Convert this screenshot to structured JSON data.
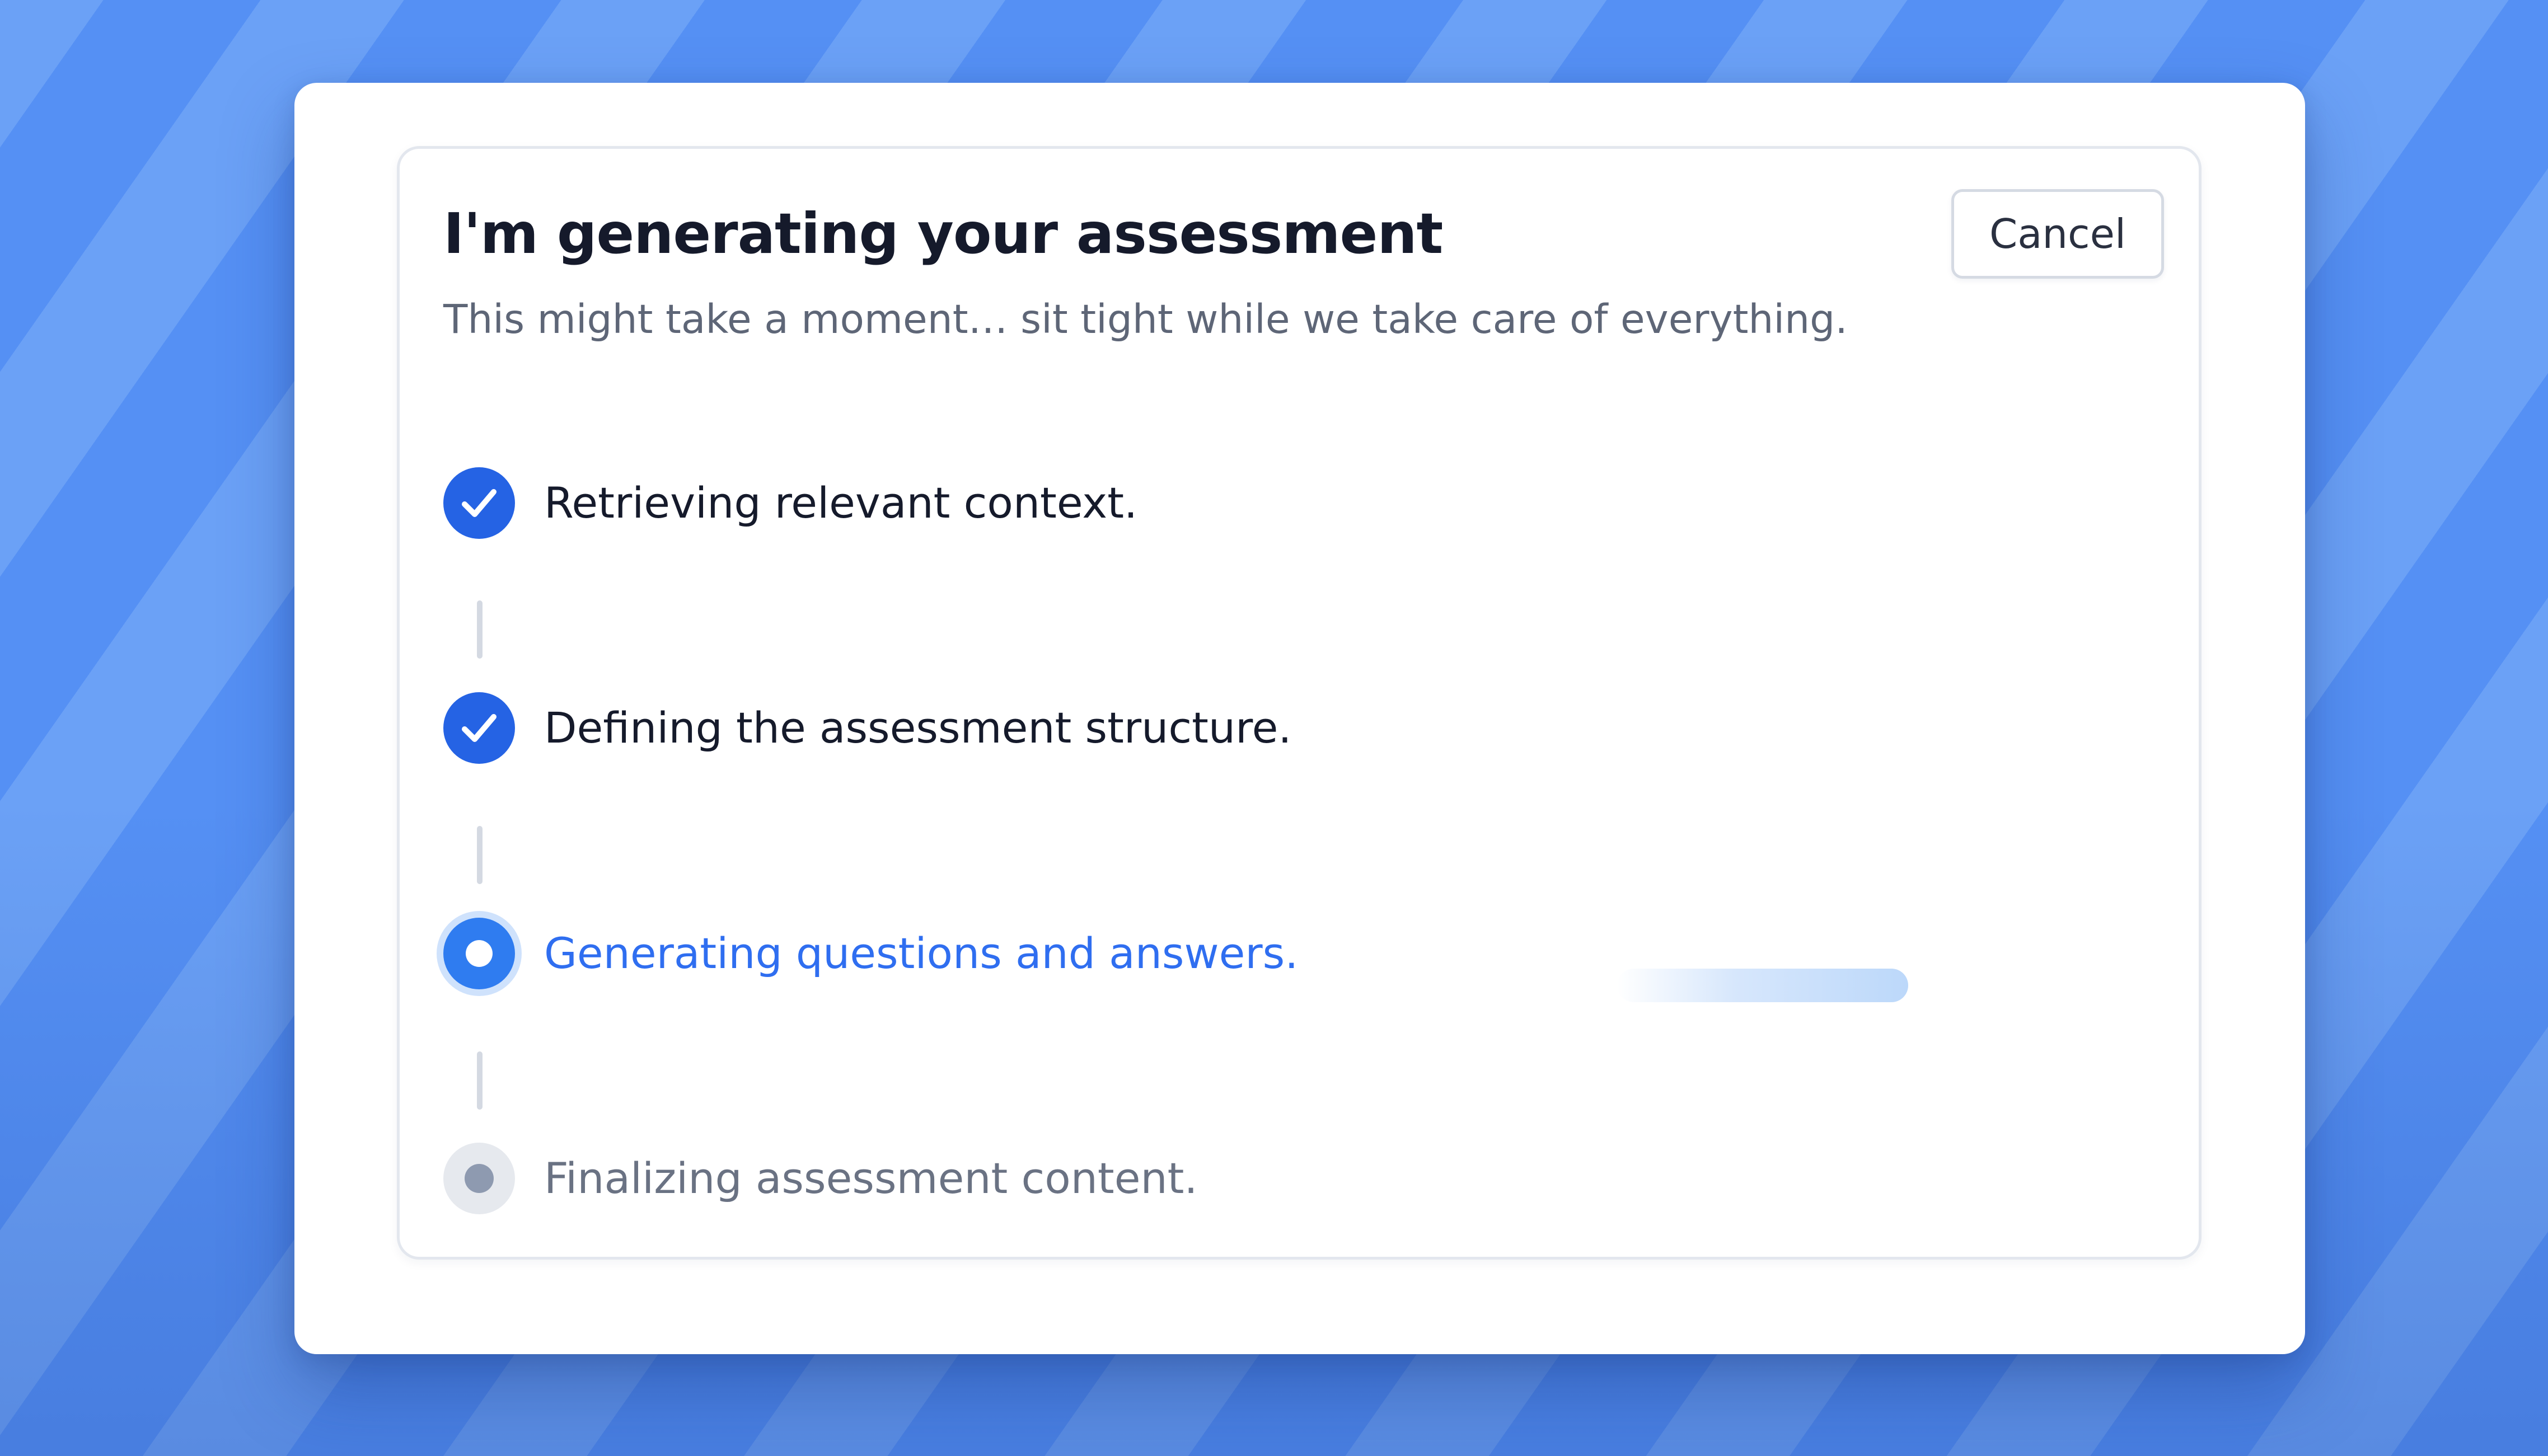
{
  "dialog": {
    "title": "I'm generating your assessment",
    "subtitle": "This might take a moment… sit tight while we take care of everything.",
    "cancel_label": "Cancel"
  },
  "steps": [
    {
      "label": "Retrieving relevant context.",
      "status": "complete",
      "icon": "check-circle-icon"
    },
    {
      "label": "Defining the assessment structure.",
      "status": "complete",
      "icon": "check-circle-icon"
    },
    {
      "label": "Generating questions and answers.",
      "status": "in-progress",
      "icon": "active-dot-icon"
    },
    {
      "label": "Finalizing assessment content.",
      "status": "pending",
      "icon": "pending-dot-icon"
    }
  ],
  "colors": {
    "accent": "#2563e4",
    "active_text": "#2f6ef0",
    "background_stripe_dark": "#5590f4",
    "background_stripe_light": "#6ba1f6",
    "pending_dot": "#8e9ab0"
  }
}
